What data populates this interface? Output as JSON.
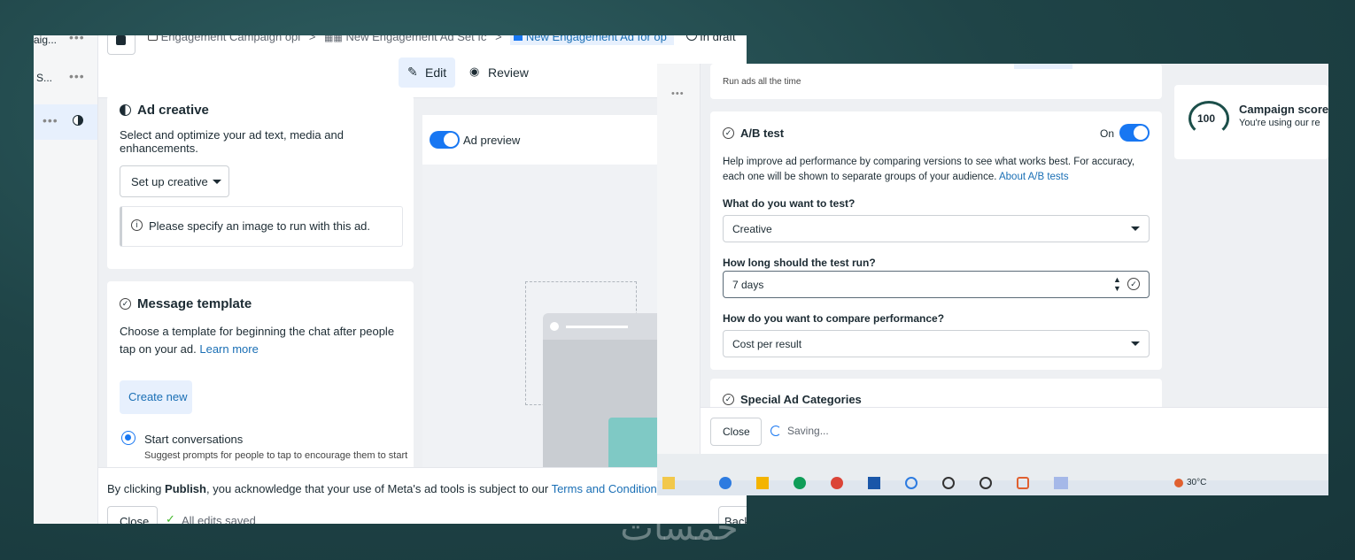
{
  "left": {
    "sidebar": {
      "item1": "aig...",
      "item2": "S...",
      "dots": "•••"
    },
    "breadcrumb": {
      "campaign": "Engagement Campaign opi",
      "adset": "New Engagement Ad Set fc",
      "ad": "New Engagement Ad for op",
      "status": "In draft",
      "separator": ">"
    },
    "modes": {
      "edit": "Edit",
      "review": "Review"
    },
    "ad_creative": {
      "title": "Ad creative",
      "description": "Select and optimize your ad text, media and enhancements.",
      "setup_button": "Set up creative",
      "info": "Please specify an image to run with this ad."
    },
    "preview": {
      "label": "Ad preview"
    },
    "message_template": {
      "title": "Message template",
      "description": "Choose a template for beginning the chat after people tap on your ad.",
      "learn_more": "Learn more",
      "create_new": "Create new",
      "option_title": "Start conversations",
      "option_desc": "Suggest prompts for people to tap to encourage them to start"
    },
    "footer": {
      "prefix": "By clicking ",
      "publish": "Publish",
      "middle": ", you acknowledge that your use of Meta's ad tools is subject to our ",
      "terms": "Terms and Conditions",
      "end": ".",
      "close": "Close",
      "saved": "All edits saved",
      "back": "Back"
    }
  },
  "right": {
    "run_ads": "Run ads all the time",
    "ab_test": {
      "title": "A/B test",
      "toggle_label": "On",
      "description": "Help improve ad performance by comparing versions to see what works best. For accuracy, each one will be shown to separate groups of your audience.",
      "about_link": "About A/B tests",
      "q1": "What do you want to test?",
      "q1_value": "Creative",
      "q2": "How long should the test run?",
      "q2_value": "7 days",
      "q3": "How do you want to compare performance?",
      "q3_value": "Cost per result"
    },
    "special_categories": "Special Ad Categories",
    "close": "Close",
    "saving": "Saving...",
    "score": {
      "value": "100",
      "title": "Campaign score",
      "subtitle": "You're using our re"
    },
    "taskbar": {
      "temp": "30°C"
    },
    "dots": "•••"
  },
  "watermark": "خمسات",
  "colors": {
    "accent": "#1877f2",
    "link": "#1a6fb5",
    "background": "#1f4447"
  }
}
